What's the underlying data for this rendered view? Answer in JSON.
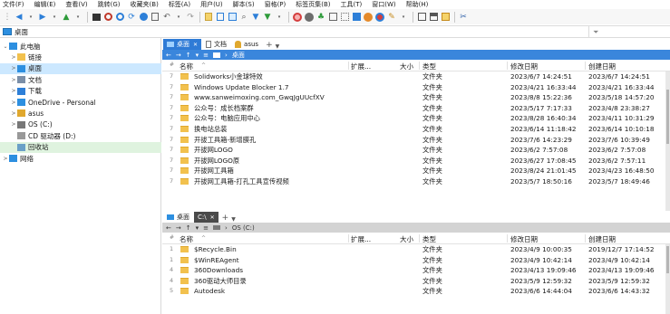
{
  "menu": [
    "文件(F)",
    "编辑(E)",
    "查看(V)",
    "跳转(G)",
    "收藏夹(B)",
    "标签(A)",
    "用户(U)",
    "脚本(S)",
    "窗格(P)",
    "标签页集(B)",
    "工具(T)",
    "窗口(W)",
    "帮助(H)"
  ],
  "address": {
    "path": "桌面",
    "filter_icon": "funnel-icon"
  },
  "tree": [
    {
      "label": "此电脑",
      "icon": "computer-icon",
      "arrow": "⌄",
      "indent": 0
    },
    {
      "label": "链接",
      "icon": "folder-icon",
      "arrow": ">",
      "indent": 1
    },
    {
      "label": "桌面",
      "icon": "desktop-icon",
      "arrow": ">",
      "indent": 1,
      "selected": true
    },
    {
      "label": "文档",
      "icon": "document-icon",
      "arrow": ">",
      "indent": 1
    },
    {
      "label": "下载",
      "icon": "download-icon",
      "arrow": ">",
      "indent": 1
    },
    {
      "label": "OneDrive - Personal",
      "icon": "cloud-icon",
      "arrow": ">",
      "indent": 1
    },
    {
      "label": "asus",
      "icon": "user-icon",
      "arrow": ">",
      "indent": 1
    },
    {
      "label": "OS (C:)",
      "icon": "drive-icon",
      "arrow": ">",
      "indent": 1
    },
    {
      "label": "CD 驱动器 (D:)",
      "icon": "cd-drive-icon",
      "arrow": "",
      "indent": 1
    },
    {
      "label": "回收站",
      "icon": "recycle-bin-icon",
      "arrow": "",
      "indent": 1,
      "green": true
    },
    {
      "label": "网络",
      "icon": "network-icon",
      "arrow": ">",
      "indent": 0
    }
  ],
  "top_pane": {
    "tabs": [
      {
        "label": "桌面",
        "active": true,
        "closable": true
      },
      {
        "label": "文档",
        "active": false
      },
      {
        "label": "asus",
        "active": false
      }
    ],
    "breadcrumb": "桌面",
    "columns": [
      "名称",
      "扩展...",
      "大小",
      "类型",
      "修改日期",
      "创建日期"
    ],
    "rows": [
      {
        "num": "7",
        "name": "Solidworks小金球特效",
        "type": "文件夹",
        "modified": "2023/6/7 14:24:51",
        "created": "2023/6/7 14:24:51"
      },
      {
        "num": "7",
        "name": "Windows Update Blocker 1.7",
        "type": "文件夹",
        "modified": "2023/4/21 16:33:44",
        "created": "2023/4/21 16:33:44"
      },
      {
        "num": "7",
        "name": "www.sanweimoxing.com_GwqJgUUcfXV",
        "type": "文件夹",
        "modified": "2023/8/8 15:22:36",
        "created": "2023/5/18 14:57:20"
      },
      {
        "num": "7",
        "name": "公众号：成长档案群",
        "type": "文件夹",
        "modified": "2023/5/17 7:17:33",
        "created": "2023/4/8 23:38:27"
      },
      {
        "num": "7",
        "name": "公众号：电脑应用中心",
        "type": "文件夹",
        "modified": "2023/8/28 16:40:34",
        "created": "2023/4/11 10:31:29"
      },
      {
        "num": "7",
        "name": "换电站总装",
        "type": "文件夹",
        "modified": "2023/6/14 11:18:42",
        "created": "2023/6/14 10:10:18"
      },
      {
        "num": "7",
        "name": "开拔工具箱-新增膜孔",
        "type": "文件夹",
        "modified": "2023/7/6 14:23:29",
        "created": "2023/7/6 10:39:49"
      },
      {
        "num": "7",
        "name": "开拔网LOGO",
        "type": "文件夹",
        "modified": "2023/6/2 7:57:08",
        "created": "2023/6/2 7:57:08"
      },
      {
        "num": "7",
        "name": "开拔网LOGO原",
        "type": "文件夹",
        "modified": "2023/6/27 17:08:45",
        "created": "2023/6/2 7:57:11"
      },
      {
        "num": "7",
        "name": "开拔网工具箱",
        "type": "文件夹",
        "modified": "2023/8/24 21:01:45",
        "created": "2023/4/23 16:48:50"
      },
      {
        "num": "7",
        "name": "开拔网工具箱-打孔工具宣传视频",
        "type": "文件夹",
        "modified": "2023/5/7 18:50:16",
        "created": "2023/5/7 18:49:46"
      }
    ]
  },
  "bottom_pane": {
    "tabs": [
      {
        "label": "桌面",
        "active": false
      },
      {
        "label": "C:\\",
        "active": true,
        "closable": true
      }
    ],
    "breadcrumb": "OS (C:)",
    "columns": [
      "名称",
      "扩展...",
      "大小",
      "类型",
      "修改日期",
      "创建日期"
    ],
    "rows": [
      {
        "num": "1",
        "name": "$Recycle.Bin",
        "type": "文件夹",
        "modified": "2023/4/9 10:00:35",
        "created": "2019/12/7 17:14:52"
      },
      {
        "num": "1",
        "name": "$WinREAgent",
        "type": "文件夹",
        "modified": "2023/4/9 10:42:14",
        "created": "2023/4/9 10:42:14"
      },
      {
        "num": "4",
        "name": "360Downloads",
        "type": "文件夹",
        "modified": "2023/4/13 19:09:46",
        "created": "2023/4/13 19:09:46"
      },
      {
        "num": "4",
        "name": "360驱动大师目录",
        "type": "文件夹",
        "modified": "2023/5/9 12:59:32",
        "created": "2023/5/9 12:59:32"
      },
      {
        "num": "5",
        "name": "Autodesk",
        "type": "文件夹",
        "modified": "2023/6/6 14:44:04",
        "created": "2023/6/6 14:43:32"
      }
    ]
  }
}
